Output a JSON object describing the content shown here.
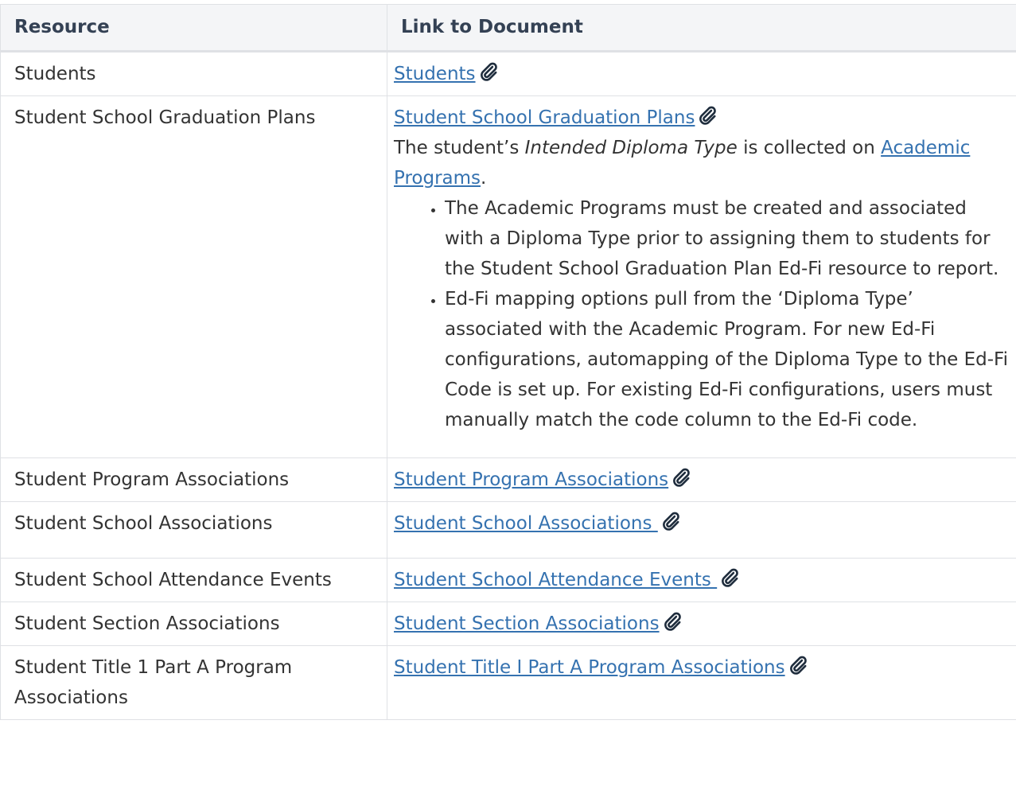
{
  "table": {
    "headers": [
      "Resource",
      "Link to Document"
    ],
    "rows": [
      {
        "resource": "Students",
        "link": "Students"
      },
      {
        "resource": "Student School Graduation Plans",
        "link": "Student School Graduation Plans",
        "note_prefix": "The student’s ",
        "note_italic": "Intended Diploma Type",
        "note_suffix": " is collected on ",
        "note_link": "Academic Programs",
        "note_end": ".",
        "bullets": [
          "The Academic Programs must be created and associated with a Diploma Type prior to assigning them to students for the Student School Graduation Plan Ed-Fi resource to report.",
          "Ed-Fi mapping options pull from the ‘Diploma Type’ associated with the Academic Program. For new Ed-Fi configurations, automapping of the Diploma Type to the Ed-Fi Code is set up. For existing Ed-Fi configurations, users must manually match the code column to the Ed-Fi code."
        ]
      },
      {
        "resource": "Student Program Associations",
        "link": "Student Program Associations"
      },
      {
        "resource": "Student School Associations",
        "link": "Student School Associations "
      },
      {
        "resource": "Student School Attendance Events",
        "link": "Student School Attendance Events "
      },
      {
        "resource": "Student Section Associations",
        "link": "Student Section Associations"
      },
      {
        "resource": "Student Title 1 Part A Program Associations",
        "link": "Student Title I Part A Program Associations"
      }
    ]
  },
  "icons": {
    "attachment": "paperclip-icon"
  },
  "colors": {
    "link": "#3572b0",
    "header_bg": "#f4f5f7",
    "border": "#dfe1e5"
  }
}
